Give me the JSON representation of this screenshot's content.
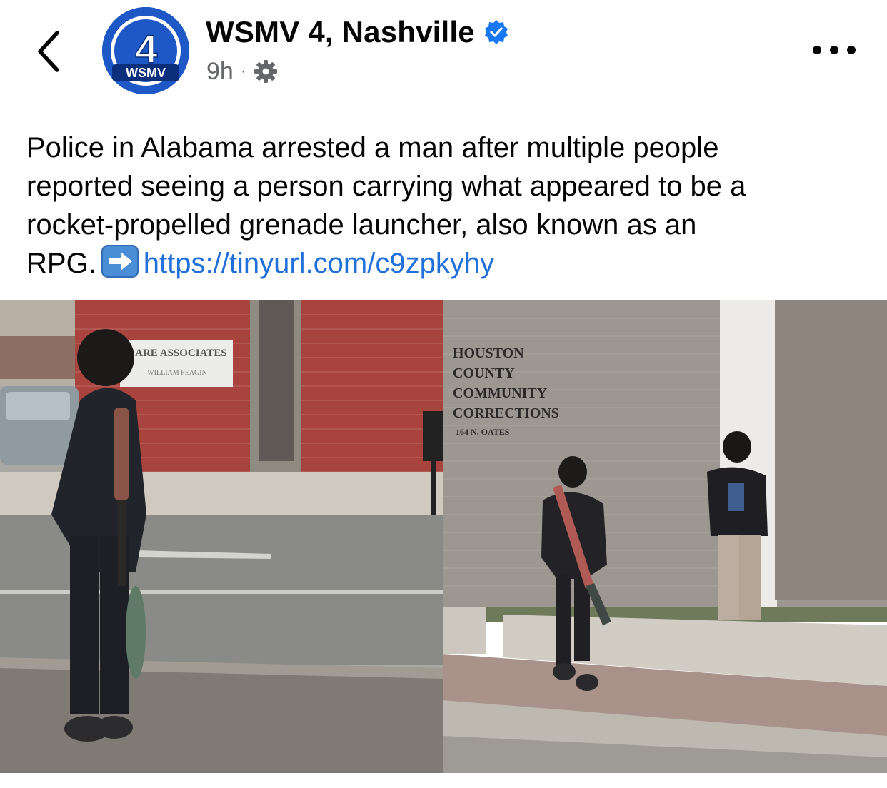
{
  "header": {
    "back_icon": "chevron-left-icon",
    "avatar": {
      "number": "4",
      "brand": "WSMV",
      "color": "#1d58c6"
    },
    "page_name": "WSMV 4, Nashville",
    "verified_icon": "verified-badge-icon",
    "time": "9h",
    "separator": "·",
    "audience_icon": "gear-icon",
    "more_icon": "more-options-icon"
  },
  "post": {
    "lines": [
      "Police in Alabama arrested a man after multiple people",
      "reported seeing a person carrying what appeared to be a",
      "rocket-propelled grenade launcher, also known as an"
    ],
    "last_line_prefix": "RPG.",
    "emoji": "arrow-right-icon",
    "link": "https://tinyurl.com/c9zpkyhy"
  },
  "photos": {
    "left": {
      "sign_line1": "CARE ASSOCIATES",
      "sign_line2": "WILLIAM FEAGIN"
    },
    "right": {
      "building_sign": [
        "HOUSTON",
        "COUNTY",
        "COMMUNITY",
        "CORRECTIONS",
        "164 N. OATES"
      ]
    }
  },
  "colors": {
    "text": "#050505",
    "secondary": "#65676b",
    "link": "#216fdb",
    "verified": "#1877f2"
  }
}
